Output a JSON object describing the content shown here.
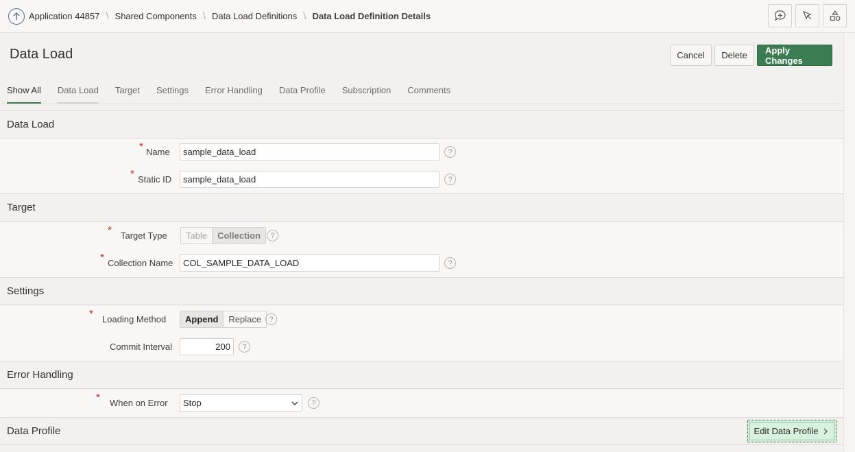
{
  "breadcrumb": {
    "items": [
      "Application 44857",
      "Shared Components",
      "Data Load Definitions",
      "Data Load Definition Details"
    ]
  },
  "page": {
    "title": "Data Load"
  },
  "actions": {
    "cancel": "Cancel",
    "delete": "Delete",
    "apply": "Apply Changes"
  },
  "tabs": [
    "Show All",
    "Data Load",
    "Target",
    "Settings",
    "Error Handling",
    "Data Profile",
    "Subscription",
    "Comments"
  ],
  "sections": {
    "data_load": {
      "title": "Data Load",
      "name_label": "Name",
      "name_value": "sample_data_load",
      "static_id_label": "Static ID",
      "static_id_value": "sample_data_load"
    },
    "target": {
      "title": "Target",
      "target_type_label": "Target Type",
      "target_type_options": [
        "Table",
        "Collection"
      ],
      "target_type_selected": "Collection",
      "collection_name_label": "Collection Name",
      "collection_name_value": "COL_SAMPLE_DATA_LOAD"
    },
    "settings": {
      "title": "Settings",
      "loading_method_label": "Loading Method",
      "loading_method_options": [
        "Append",
        "Replace"
      ],
      "loading_method_selected": "Append",
      "commit_interval_label": "Commit Interval",
      "commit_interval_value": "200"
    },
    "error_handling": {
      "title": "Error Handling",
      "when_on_error_label": "When on Error",
      "when_on_error_value": "Stop"
    },
    "data_profile": {
      "title": "Data Profile",
      "edit_button": "Edit Data Profile"
    }
  },
  "colors": {
    "primary": "#3c7c52",
    "required": "#d11f1f",
    "focus_button_bg": "#d8f2df"
  }
}
